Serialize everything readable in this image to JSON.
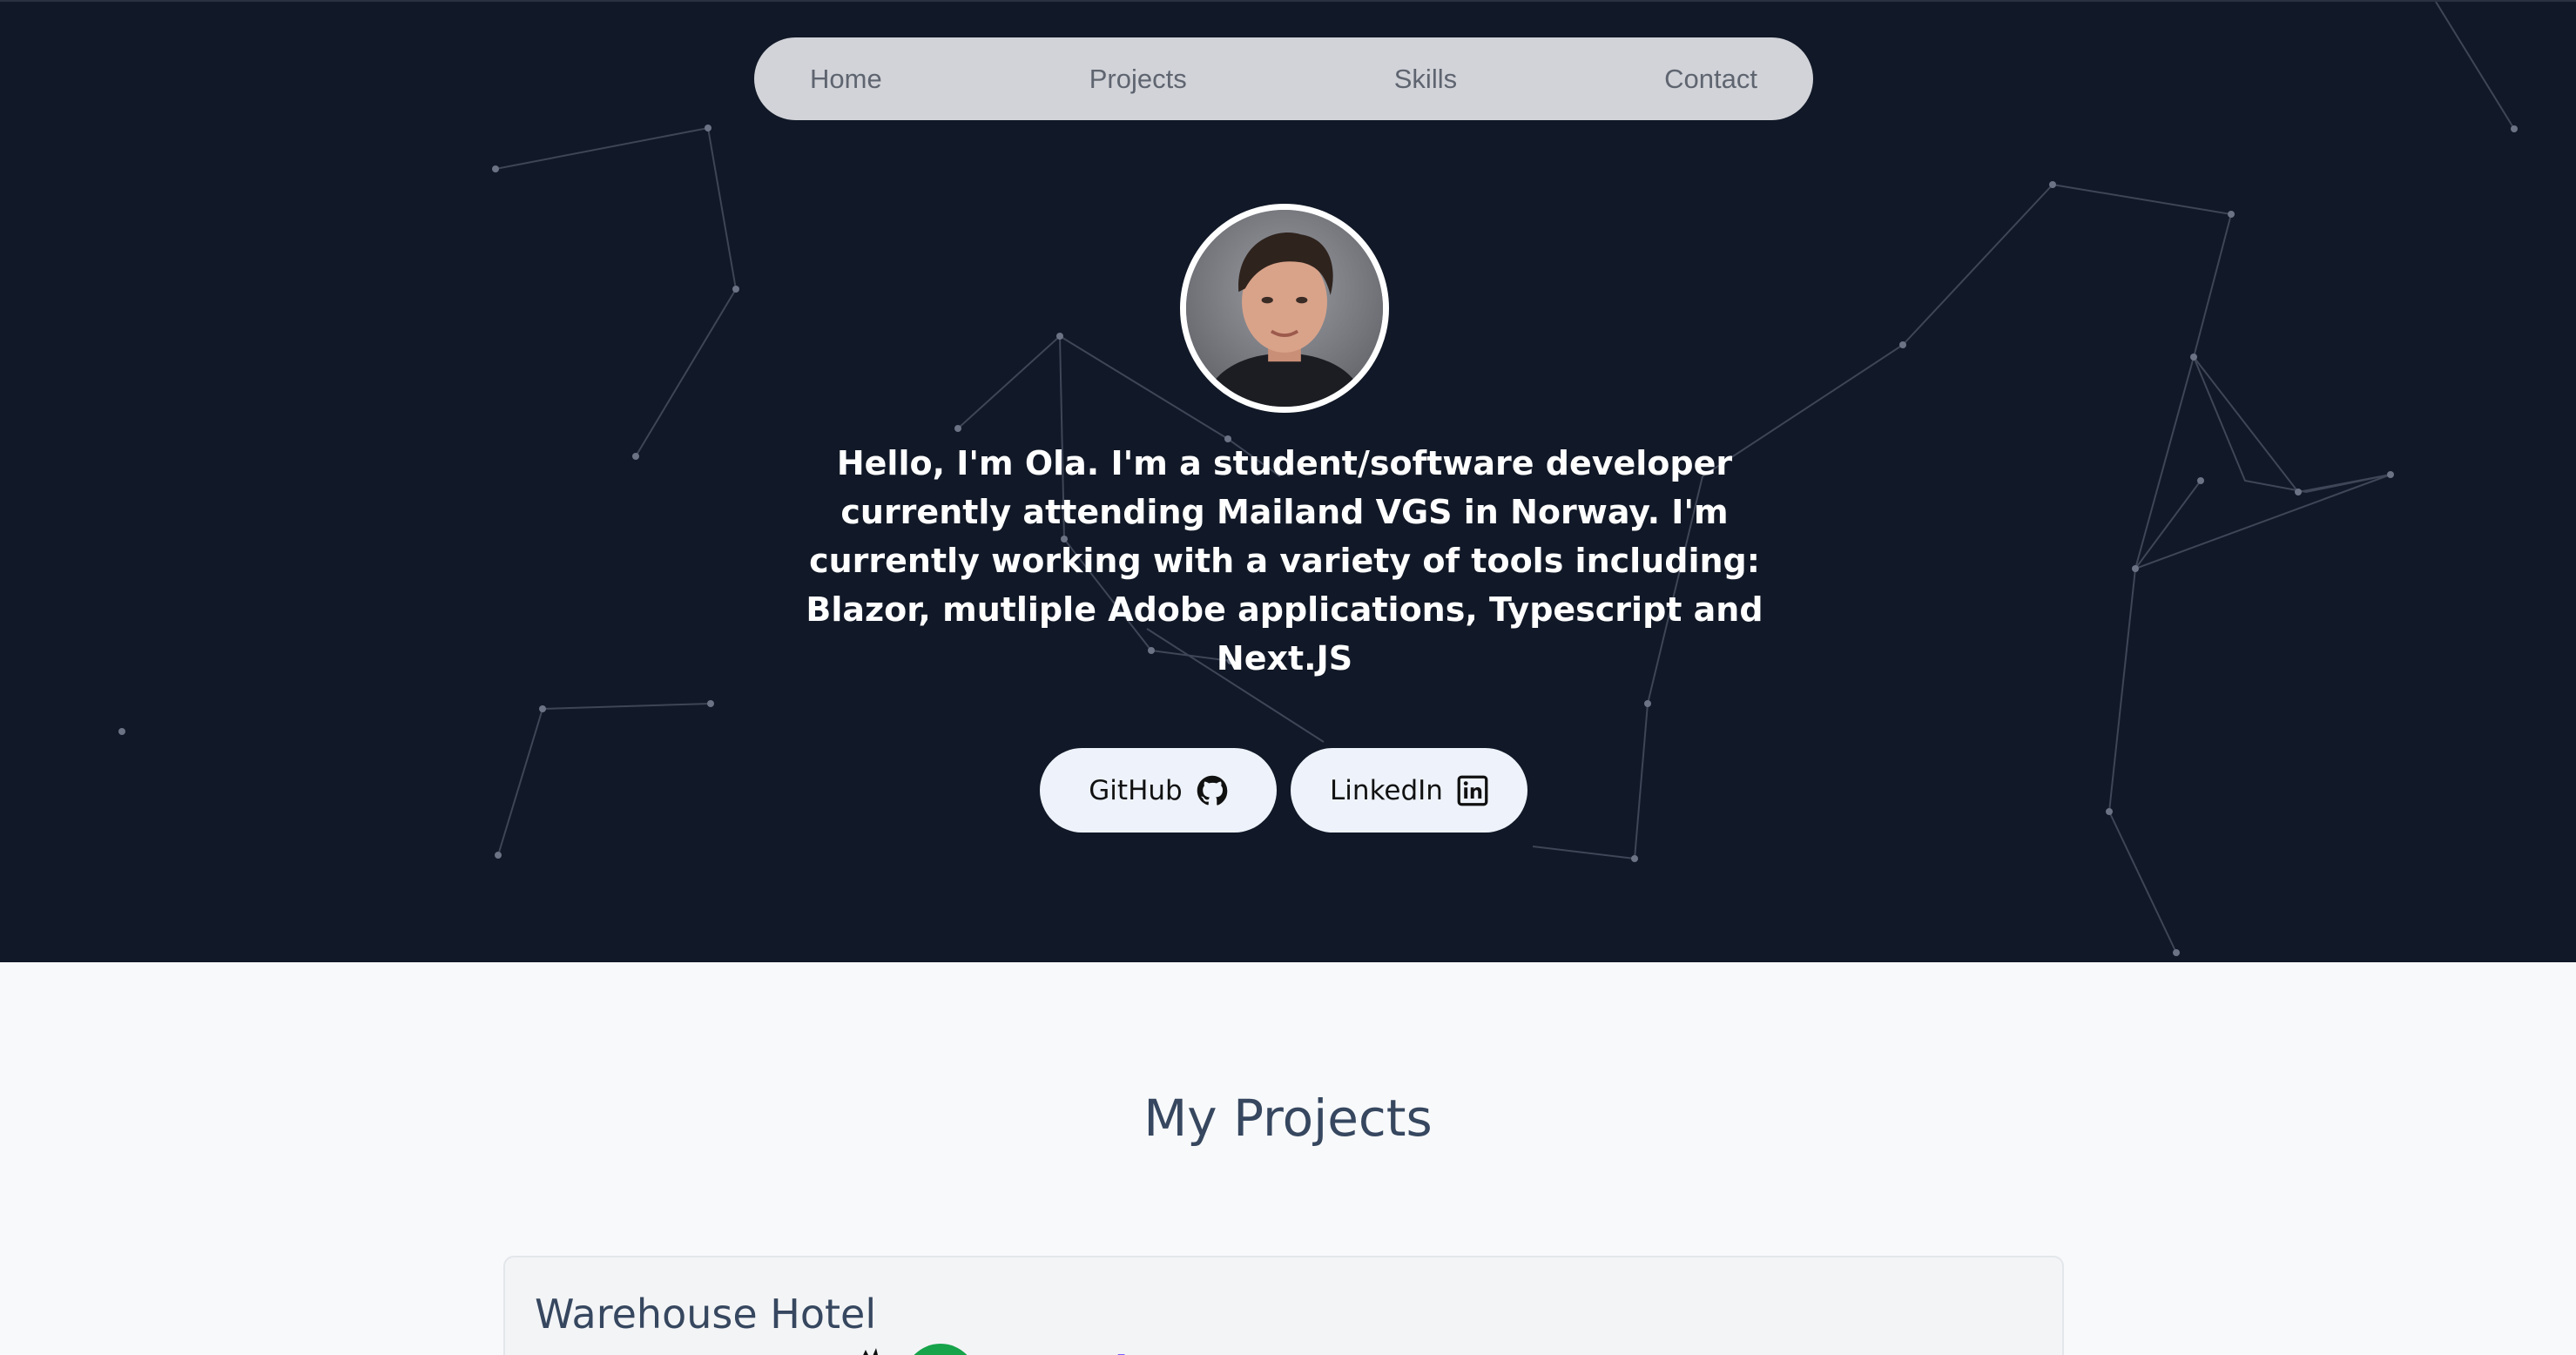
{
  "nav": {
    "items": [
      {
        "label": "Home"
      },
      {
        "label": "Projects"
      },
      {
        "label": "Skills"
      },
      {
        "label": "Contact"
      }
    ]
  },
  "hero": {
    "intro": "Hello, I'm Ola. I'm a student/software developer currently attending Mailand VGS in Norway. I'm currently working with a variety of tools including: Blazor, mutliple Adobe applications, Typescript and Next.JS",
    "avatar_icon": "profile-photo",
    "buttons": {
      "github": {
        "label": "GitHub",
        "icon": "github-icon"
      },
      "linkedin": {
        "label": "LinkedIn",
        "icon": "linkedin-icon"
      }
    }
  },
  "projects": {
    "title": "My Projects",
    "cards": [
      {
        "title": "Warehouse Hotel"
      }
    ]
  },
  "colors": {
    "hero_bg": "#111827",
    "nav_bg": "#d1d3d8",
    "button_bg": "#eef3fb",
    "heading": "#36475f",
    "page_bg": "#f8f9fb"
  }
}
